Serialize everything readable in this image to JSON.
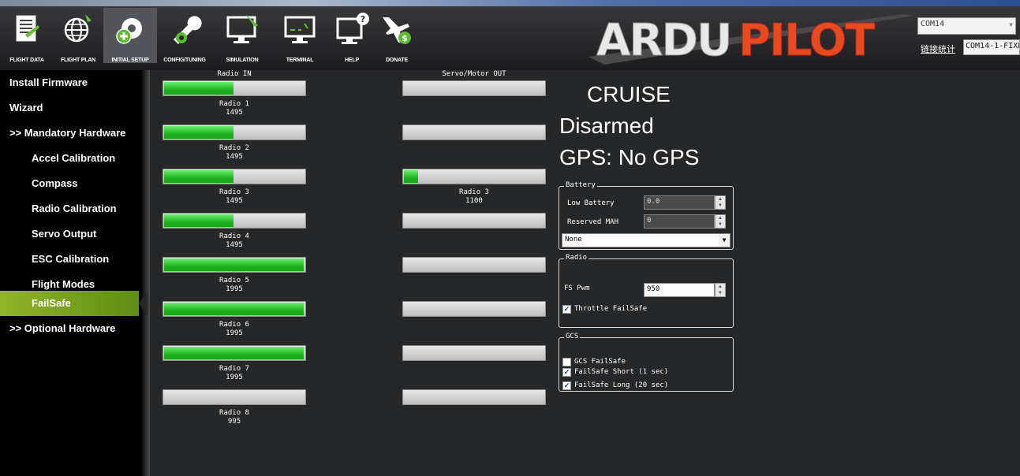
{
  "toolbar": {
    "items": [
      {
        "label": "FLIGHT DATA",
        "icon": "flight-data-icon"
      },
      {
        "label": "FLIGHT PLAN",
        "icon": "globe-icon"
      },
      {
        "label": "INITIAL SETUP",
        "icon": "initial-setup-icon"
      },
      {
        "label": "CONFIG/TUNING",
        "icon": "wrench-icon"
      },
      {
        "label": "SIMULATION",
        "icon": "simulation-monitor-icon"
      },
      {
        "label": "TERMINAL",
        "icon": "terminal-monitor-icon"
      },
      {
        "label": "HELP",
        "icon": "help-monitor-icon"
      },
      {
        "label": "DONATE",
        "icon": "donate-plane-icon"
      }
    ],
    "logo_text": "ARDUPILOT",
    "com_port": "COM14",
    "stats_link": "链接统计",
    "baud_value": "COM14-1-FIXE"
  },
  "sidebar": {
    "items": [
      {
        "label": "Install Firmware"
      },
      {
        "label": "Wizard"
      },
      {
        "label": ">> Mandatory Hardware"
      },
      {
        "label": "Accel Calibration"
      },
      {
        "label": "Compass"
      },
      {
        "label": "Radio Calibration"
      },
      {
        "label": "Servo Output"
      },
      {
        "label": "ESC Calibration"
      },
      {
        "label": "Flight Modes"
      },
      {
        "label": "FailSafe"
      },
      {
        "label": ">> Optional Hardware"
      }
    ],
    "active": "FailSafe"
  },
  "radio_in": {
    "header": "Radio IN",
    "channels": [
      {
        "label": "Radio 1",
        "value": "1495",
        "fill": 0.495
      },
      {
        "label": "Radio 2",
        "value": "1495",
        "fill": 0.495
      },
      {
        "label": "Radio 3",
        "value": "1495",
        "fill": 0.495
      },
      {
        "label": "Radio 4",
        "value": "1495",
        "fill": 0.495
      },
      {
        "label": "Radio 5",
        "value": "1995",
        "fill": 0.995
      },
      {
        "label": "Radio 6",
        "value": "1995",
        "fill": 0.995
      },
      {
        "label": "Radio 7",
        "value": "1995",
        "fill": 0.995
      },
      {
        "label": "Radio 8",
        "value": "995",
        "fill": 0.0
      }
    ]
  },
  "servo_out": {
    "header": "Servo/Motor OUT",
    "channels": [
      {
        "label": "",
        "value": "",
        "fill": 0
      },
      {
        "label": "",
        "value": "",
        "fill": 0
      },
      {
        "label": "Radio 3",
        "value": "1100",
        "fill": 0.1
      },
      {
        "label": "",
        "value": "",
        "fill": 0
      },
      {
        "label": "",
        "value": "",
        "fill": 0
      },
      {
        "label": "",
        "value": "",
        "fill": 0
      },
      {
        "label": "",
        "value": "",
        "fill": 0
      },
      {
        "label": "",
        "value": "",
        "fill": 0
      }
    ]
  },
  "status": {
    "mode": "CRUISE",
    "armed": "Disarmed",
    "gps": "GPS: No GPS"
  },
  "battery": {
    "title": "Battery",
    "low_battery_label": "Low Battery",
    "low_battery_value": "0.0",
    "reserved_mah_label": "Reserved MAH",
    "reserved_mah_value": "0",
    "action": "None"
  },
  "radio": {
    "title": "Radio",
    "fs_pwm_label": "FS Pwm",
    "fs_pwm_value": "950",
    "throttle_failsafe_label": "Throttle FailSafe",
    "throttle_failsafe_checked": true
  },
  "gcs": {
    "title": "GCS",
    "gcs_failsafe_label": "GCS FailSafe",
    "gcs_failsafe_checked": false,
    "short_label": "FailSafe Short (1 sec)",
    "short_checked": true,
    "long_label": "FailSafe Long (20 sec)",
    "long_checked": true
  },
  "colors": {
    "bar_fill": "#1fb31f",
    "active_item": "#7ea21f",
    "background": "#262729"
  }
}
